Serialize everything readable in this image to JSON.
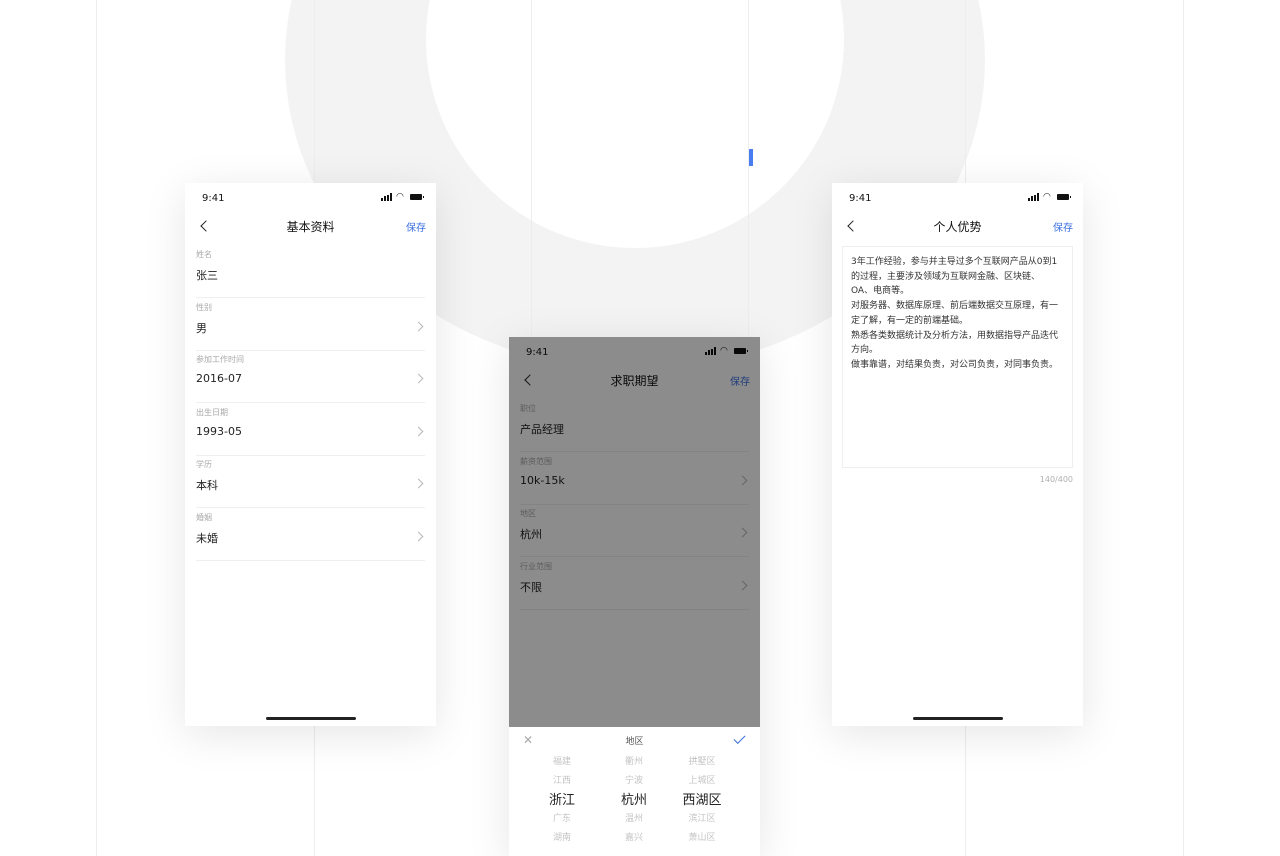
{
  "status_time": "9:41",
  "accent_color": "#3a6fe0",
  "basic_info": {
    "title": "基本资料",
    "save_label": "保存",
    "fields": [
      {
        "label": "姓名",
        "value": "张三",
        "chevron": false
      },
      {
        "label": "性别",
        "value": "男",
        "chevron": true
      },
      {
        "label": "参加工作时间",
        "value": "2016-07",
        "chevron": true
      },
      {
        "label": "出生日期",
        "value": "1993-05",
        "chevron": true
      },
      {
        "label": "学历",
        "value": "本科",
        "chevron": true
      },
      {
        "label": "婚姻",
        "value": "未婚",
        "chevron": true
      }
    ]
  },
  "job_expectation": {
    "title": "求职期望",
    "save_label": "保存",
    "fields": [
      {
        "label": "职位",
        "value": "产品经理",
        "chevron": false
      },
      {
        "label": "薪资范围",
        "value": "10k-15k",
        "chevron": true
      },
      {
        "label": "地区",
        "value": "杭州",
        "chevron": true
      },
      {
        "label": "行业范围",
        "value": "不限",
        "chevron": true
      }
    ],
    "picker": {
      "title": "地区",
      "close_icon": "close-icon",
      "confirm_icon": "check-icon",
      "provinces": [
        "福建",
        "江西",
        "浙江",
        "广东",
        "湖南"
      ],
      "cities": [
        "衢州",
        "宁波",
        "杭州",
        "温州",
        "嘉兴"
      ],
      "districts": [
        "拱墅区",
        "上城区",
        "西湖区",
        "滨江区",
        "萧山区"
      ],
      "selected_index": 2
    }
  },
  "personal_strengths": {
    "title": "个人优势",
    "save_label": "保存",
    "text_lines": [
      "3年工作经验，参与并主导过多个互联网产品从0到1",
      "的过程，主要涉及领域为互联网金融、区块链、",
      "OA、电商等。",
      "对服务器、数据库原理、前后端数据交互原理，有一",
      "定了解，有一定的前端基础。",
      "熟悉各类数据统计及分析方法，用数据指导产品迭代",
      "方向。",
      "做事靠谱，对结果负责，对公司负责，对同事负责。"
    ],
    "counter": "140/400"
  }
}
